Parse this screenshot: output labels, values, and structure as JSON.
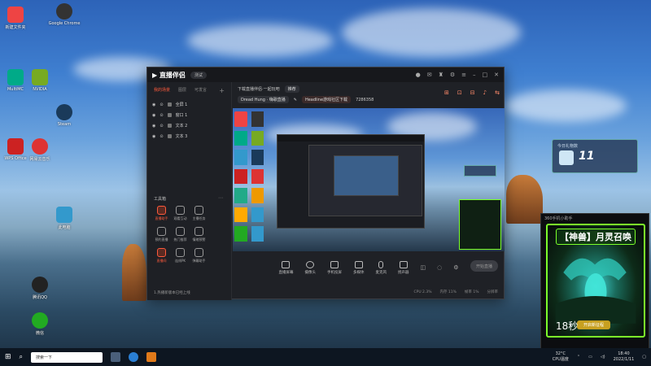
{
  "desktop": {
    "icons": [
      {
        "label": "新建文件夹",
        "color": "#e44"
      },
      {
        "label": "Google Chrome",
        "color": "#333"
      },
      {
        "label": "MultiMC",
        "color": "#0a8"
      },
      {
        "label": "NVIDIA",
        "color": "#7a2"
      },
      {
        "label": "WPS Office",
        "color": "#c22"
      },
      {
        "label": "网易云音乐",
        "color": "#d33"
      },
      {
        "label": "Steam",
        "color": "#1a3a5a"
      },
      {
        "label": "腾讯QQ",
        "color": "#222"
      },
      {
        "label": "微信",
        "color": "#2a2"
      },
      {
        "label": "此电脑",
        "color": "#39c"
      }
    ]
  },
  "window": {
    "logo": "直播伴侣",
    "version_pill": "测试",
    "left_tabs": [
      "我的场景",
      "图层",
      "可发言"
    ],
    "sources": [
      "全屏 1",
      "窗口 1",
      "文本 2",
      "文本 3"
    ],
    "tools_heading": "工具箱",
    "tools": [
      {
        "label": "直播助手",
        "hot": true
      },
      {
        "label": "观看互动",
        "hot": false
      },
      {
        "label": "主播任务",
        "hot": false
      },
      {
        "label": "",
        "hot": false
      },
      {
        "label": "预约直播",
        "hot": false
      },
      {
        "label": "热门推荐",
        "hot": false
      },
      {
        "label": "情绪预警",
        "hot": false
      },
      {
        "label": "",
        "hot": false
      },
      {
        "label": "直播间",
        "hot": true
      },
      {
        "label": "连线PK",
        "hot": false
      },
      {
        "label": "弹幕助手",
        "hot": false
      },
      {
        "label": "",
        "hot": false
      }
    ],
    "footer_note": "1.热播新版本已经上线",
    "scene_title": "下载直播伴侣·一起玩吧",
    "scene_tag": "推荐",
    "scene_subtags": [
      "Dread Hung · 嗨歌直播",
      "Headline游戏社区下载",
      "7286358"
    ],
    "controls": [
      "直播屏幕",
      "摄像头",
      "手机投屏",
      "多媒体",
      "麦克风",
      "扬声器"
    ],
    "go_live": "开始直播",
    "status": [
      "CPU 2.3%",
      "内存 11%",
      "帧率 1%",
      "分辨率"
    ]
  },
  "widgets": {
    "gift_label": "今日礼物数",
    "gift_count": "11",
    "game_header": "360手机小助手",
    "game_title": "【神兽】月灵召唤",
    "game_timer": "18秒",
    "game_cta": "开启新征程"
  },
  "taskbar": {
    "search_placeholder": "搜索一下",
    "temperature": "32°C",
    "cpu_label": "CPU温度",
    "time": "18:40",
    "date": "2022/1/11"
  },
  "colors": {
    "accent": "#ff5a3c",
    "neon_green": "#7cff2a"
  }
}
